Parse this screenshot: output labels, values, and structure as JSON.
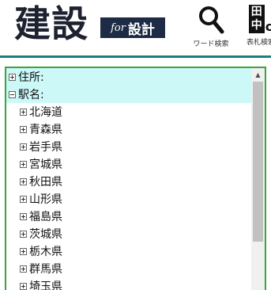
{
  "header": {
    "logo_main": "建設",
    "logo_for": "for",
    "logo_sekkei": "設計",
    "word_search_label": "ワード検索",
    "table_search_label": "表札検索",
    "table_search_icon_top": "田",
    "table_search_icon_bottom": "中",
    "table_search_icon_suffix": "c"
  },
  "tree": {
    "items": [
      {
        "label": "住所:",
        "expanded": false
      },
      {
        "label": "駅名:",
        "expanded": true
      }
    ],
    "children": [
      "北海道",
      "青森県",
      "岩手県",
      "宮城県",
      "秋田県",
      "山形県",
      "福島県",
      "茨城県",
      "栃木県",
      "群馬県",
      "埼玉県"
    ]
  },
  "scrollbar": {
    "up_arrow": "▲"
  },
  "colors": {
    "divider": "#1e7e7e",
    "panel_border": "#3aa53a",
    "highlight": "#ccf8f8",
    "badge": "#1d2b44"
  }
}
